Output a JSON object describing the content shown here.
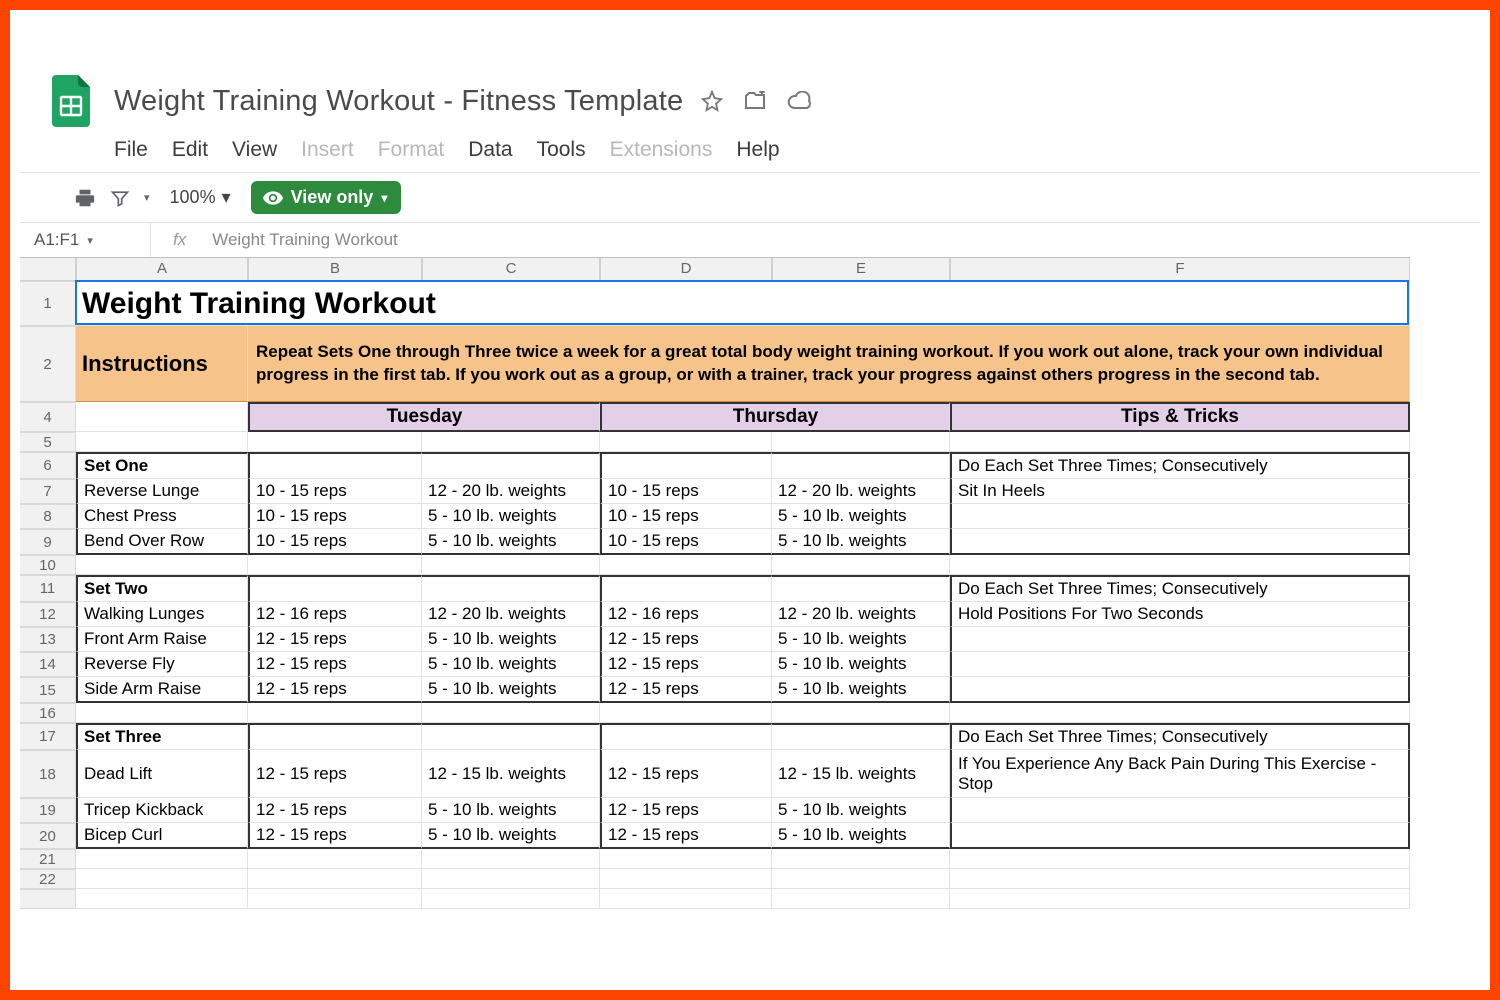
{
  "app": {
    "doc_title": "Weight Training Workout - Fitness Template",
    "menus": {
      "file": "File",
      "edit": "Edit",
      "view": "View",
      "insert": "Insert",
      "format": "Format",
      "data": "Data",
      "tools": "Tools",
      "extensions": "Extensions",
      "help": "Help"
    },
    "zoom": "100%",
    "view_only_label": "View only"
  },
  "namebox": {
    "ref": "A1:F1",
    "formula_value": "Weight Training Workout"
  },
  "columns": [
    "A",
    "B",
    "C",
    "D",
    "E",
    "F"
  ],
  "sheet": {
    "title": "Weight Training Workout",
    "instructions_label": "Instructions",
    "instructions_body": "Repeat Sets One through Three twice a week for a great total body weight training workout.  If you work out alone, track your own individual progress in the first tab.  If you work out as a group, or with a trainer, track your progress against others progress in the second tab.",
    "day_headers": {
      "tue": "Tuesday",
      "thu": "Thursday",
      "tips": "Tips & Tricks"
    },
    "rows": [
      {
        "n": 4,
        "type": "dayhdr"
      },
      {
        "n": 5,
        "type": "blank"
      },
      {
        "n": 6,
        "type": "set",
        "a": "Set One",
        "f": "Do Each Set Three Times; Consecutively"
      },
      {
        "n": 7,
        "type": "ex",
        "a": "Reverse Lunge",
        "b": "10 - 15 reps",
        "c": "12 - 20 lb. weights",
        "d": "10 - 15 reps",
        "e": "12 - 20 lb. weights",
        "f": "Sit In Heels"
      },
      {
        "n": 8,
        "type": "ex",
        "a": "Chest Press",
        "b": "10 - 15 reps",
        "c": "5 - 10 lb. weights",
        "d": "10 - 15 reps",
        "e": "5 - 10 lb. weights",
        "f": ""
      },
      {
        "n": 9,
        "type": "ex",
        "a": "Bend Over Row",
        "b": "10 - 15 reps",
        "c": "5 - 10 lb. weights",
        "d": "10 - 15 reps",
        "e": "5 - 10 lb. weights",
        "f": "",
        "endset": true
      },
      {
        "n": 10,
        "type": "blank"
      },
      {
        "n": 11,
        "type": "set",
        "a": "Set Two",
        "f": "Do Each Set Three Times; Consecutively"
      },
      {
        "n": 12,
        "type": "ex",
        "a": "Walking Lunges",
        "b": "12 - 16 reps",
        "c": "12 - 20 lb. weights",
        "d": "12 - 16 reps",
        "e": "12 - 20 lb. weights",
        "f": "Hold Positions For Two Seconds"
      },
      {
        "n": 13,
        "type": "ex",
        "a": "Front Arm Raise",
        "b": "12 - 15 reps",
        "c": "5 - 10 lb. weights",
        "d": "12 - 15 reps",
        "e": "5 - 10 lb. weights",
        "f": ""
      },
      {
        "n": 14,
        "type": "ex",
        "a": "Reverse Fly",
        "b": "12 - 15 reps",
        "c": "5 - 10 lb. weights",
        "d": "12 - 15 reps",
        "e": "5 - 10 lb. weights",
        "f": ""
      },
      {
        "n": 15,
        "type": "ex",
        "a": "Side Arm Raise",
        "b": "12 - 15 reps",
        "c": "5 - 10 lb. weights",
        "d": "12 - 15 reps",
        "e": "5 - 10 lb. weights",
        "f": "",
        "endset": true
      },
      {
        "n": 16,
        "type": "blank"
      },
      {
        "n": 17,
        "type": "set",
        "a": "Set Three",
        "f": "Do Each Set Three Times; Consecutively"
      },
      {
        "n": 18,
        "type": "ex",
        "a": "Dead Lift",
        "b": "12 - 15 reps",
        "c": "12 - 15 lb. weights",
        "d": "12 - 15 reps",
        "e": "12 - 15 lb. weights",
        "f": "If You Experience Any Back Pain During This Exercise - Stop",
        "tall": true
      },
      {
        "n": 19,
        "type": "ex",
        "a": "Tricep Kickback",
        "b": "12 - 15 reps",
        "c": "5 - 10 lb. weights",
        "d": "12 - 15 reps",
        "e": "5 - 10 lb. weights",
        "f": ""
      },
      {
        "n": 20,
        "type": "ex",
        "a": "Bicep Curl",
        "b": "12 - 15 reps",
        "c": "5 - 10 lb. weights",
        "d": "12 - 15 reps",
        "e": "5 - 10 lb. weights",
        "f": "",
        "endset": true
      },
      {
        "n": 21,
        "type": "blank"
      },
      {
        "n": 22,
        "type": "blank"
      },
      {
        "n": "",
        "type": "blank"
      }
    ]
  }
}
